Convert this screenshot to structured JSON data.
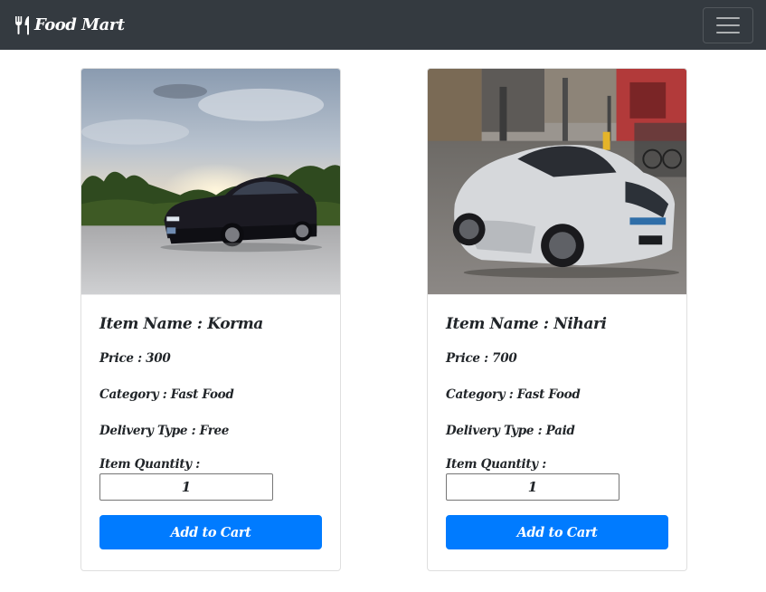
{
  "navbar": {
    "brand_icon": "utensils-icon",
    "brand_text": "Food Mart",
    "toggler_icon": "hamburger-menu-icon",
    "background": "#343a40"
  },
  "products": [
    {
      "image_icon": "dark-sedan-car-photo",
      "name": "Item Name : Korma",
      "price": "Price : 300",
      "category": "Category : Fast Food",
      "delivery": "Delivery Type : Free",
      "quantity_label": "Item Quantity :",
      "quantity": "1",
      "button": "Add to Cart"
    },
    {
      "image_icon": "white-sports-car-photo",
      "name": "Item Name : Nihari",
      "price": "Price : 700",
      "category": "Category : Fast Food",
      "delivery": "Delivery Type : Paid",
      "quantity_label": "Item Quantity :",
      "quantity": "1",
      "button": "Add to Cart"
    }
  ],
  "colors": {
    "accent": "#007bff",
    "text": "#212529"
  }
}
